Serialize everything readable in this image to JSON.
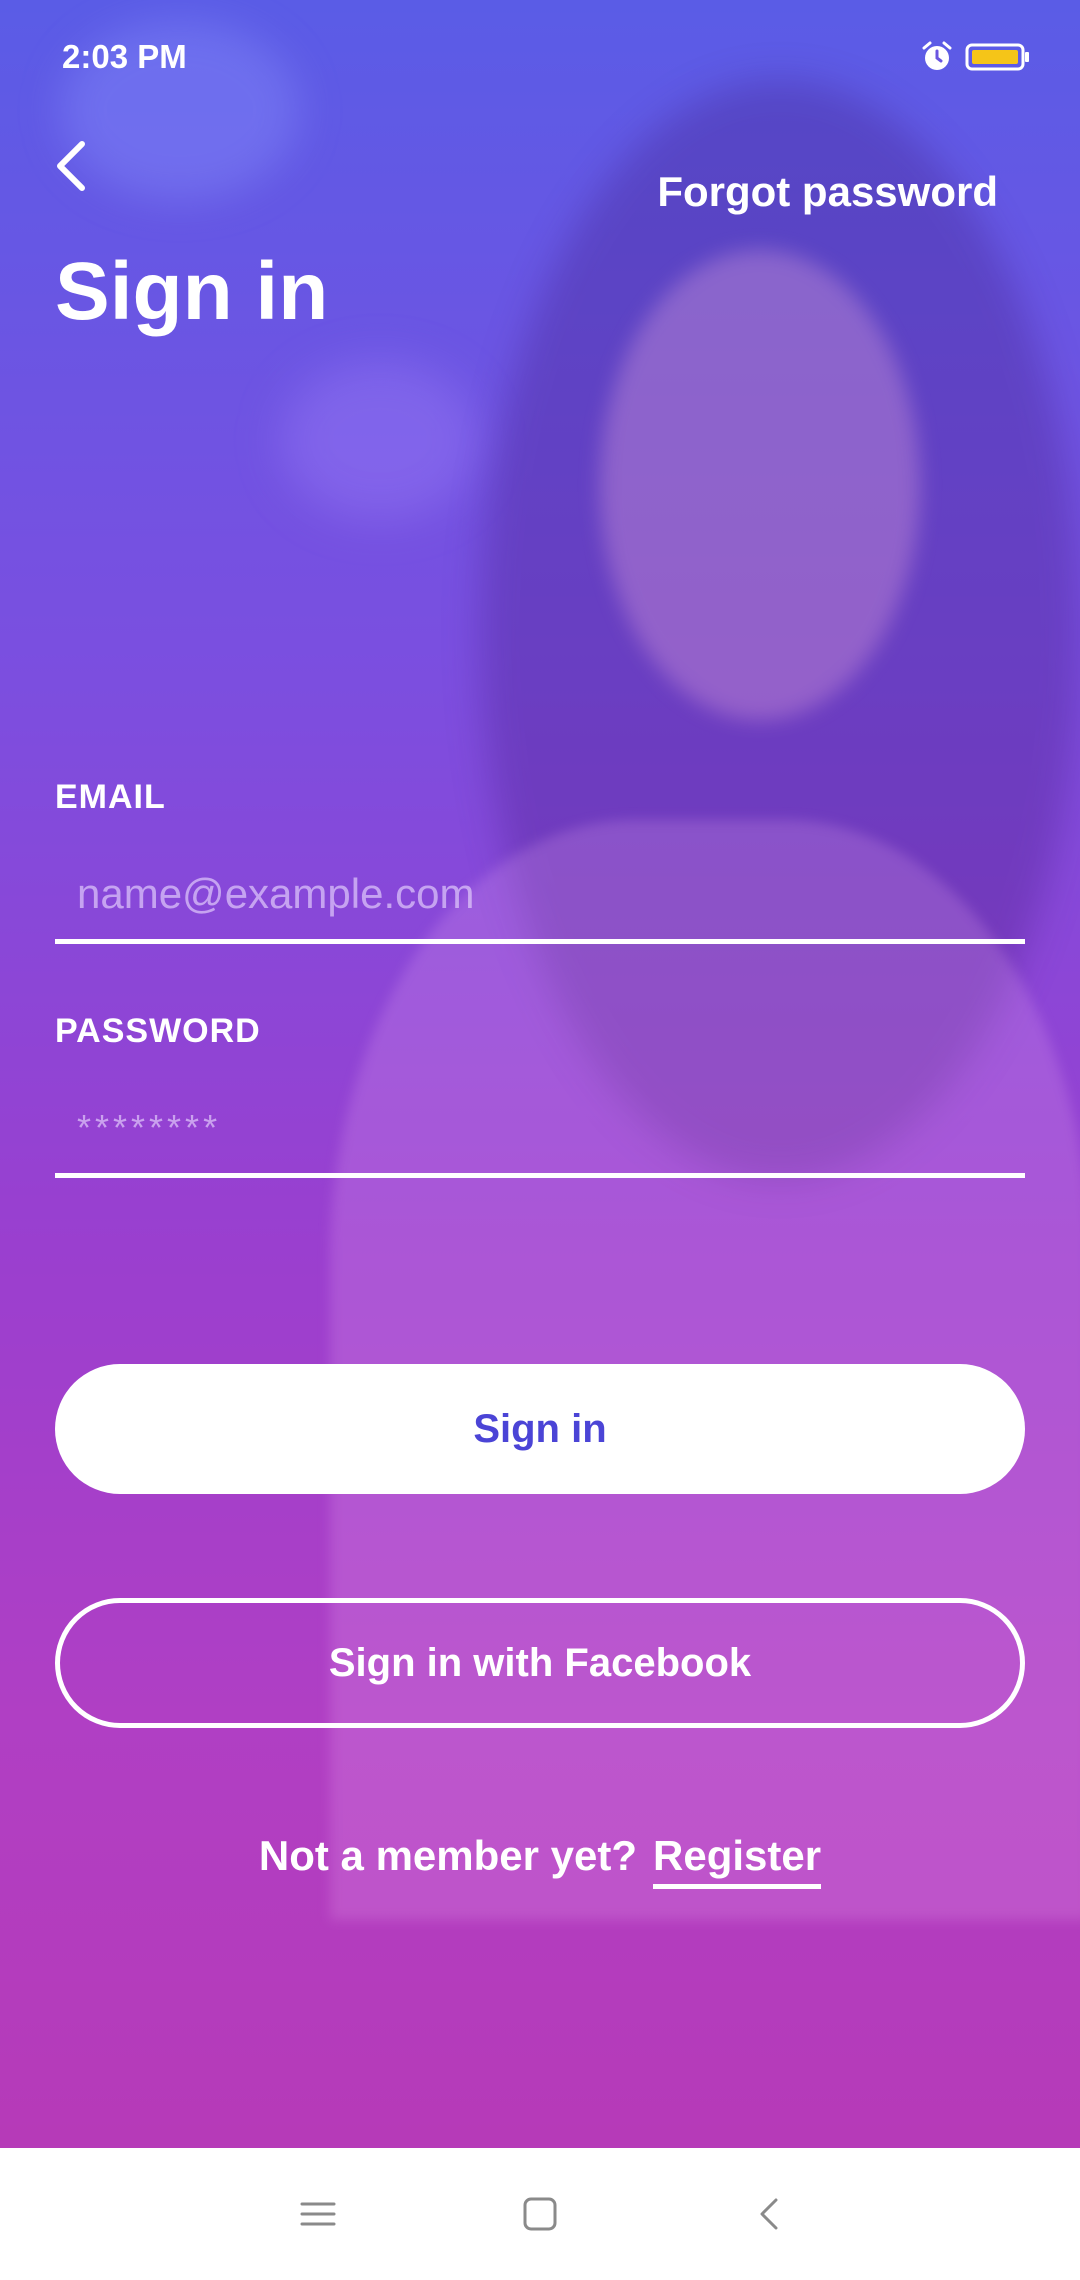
{
  "status_bar": {
    "time": "2:03 PM",
    "icons": [
      "alarm-icon",
      "battery-icon"
    ],
    "battery_color": "#f5c518"
  },
  "header": {
    "back_icon": "chevron-left-icon",
    "forgot_password": "Forgot password",
    "title": "Sign in"
  },
  "form": {
    "email": {
      "label": "EMAIL",
      "placeholder": "name@example.com",
      "value": ""
    },
    "password": {
      "label": "PASSWORD",
      "placeholder": "********",
      "value": ""
    }
  },
  "buttons": {
    "sign_in": "Sign in",
    "sign_in_facebook": "Sign in with Facebook"
  },
  "register": {
    "prompt": "Not a member yet?",
    "link": "Register"
  },
  "nav_bar": {
    "items": [
      "menu-icon",
      "home-icon",
      "back-icon"
    ]
  },
  "colors": {
    "gradient_top": "#5a5ce6",
    "gradient_bottom": "#b63ab8",
    "primary_button_text": "#4b44d6"
  }
}
